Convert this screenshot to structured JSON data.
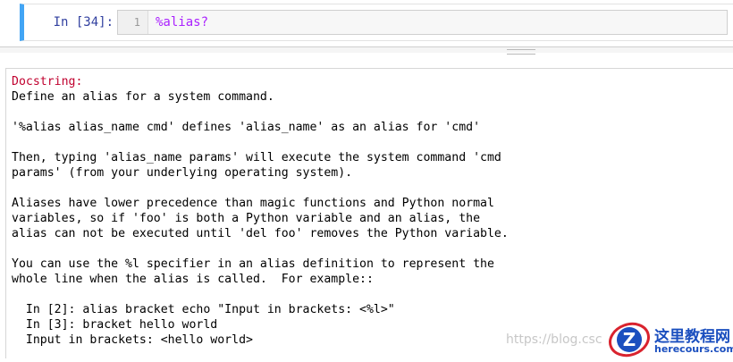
{
  "cell": {
    "prompt_prefix": "In [",
    "prompt_number": "34",
    "prompt_suffix": "]:",
    "line_number": "1",
    "code_magic": "%alias",
    "code_query": "?"
  },
  "pager": {
    "label": "Docstring:",
    "lines": [
      "Define an alias for a system command.",
      "",
      "'%alias alias_name cmd' defines 'alias_name' as an alias for 'cmd'",
      "",
      "Then, typing 'alias_name params' will execute the system command 'cmd",
      "params' (from your underlying operating system).",
      "",
      "Aliases have lower precedence than magic functions and Python normal",
      "variables, so if 'foo' is both a Python variable and an alias, the",
      "alias can not be executed until 'del foo' removes the Python variable.",
      "",
      "You can use the %l specifier in an alias definition to represent the",
      "whole line when the alias is called.  For example::",
      "",
      "  In [2]: alias bracket echo \"Input in brackets: <%l>\"",
      "  In [3]: bracket hello world",
      "  Input in brackets: <hello world>"
    ]
  },
  "watermark": {
    "url_text": "https://blog.csc",
    "logo_cn": "这里教程网",
    "logo_en": "herecours.com"
  },
  "colors": {
    "cell_border_active": "#42a5f5",
    "prompt": "#303f9f",
    "magic": "#aa22ff",
    "docstring_label": "#c0002e",
    "logo_blue": "#1b4fbf",
    "logo_red": "#d9232e"
  }
}
